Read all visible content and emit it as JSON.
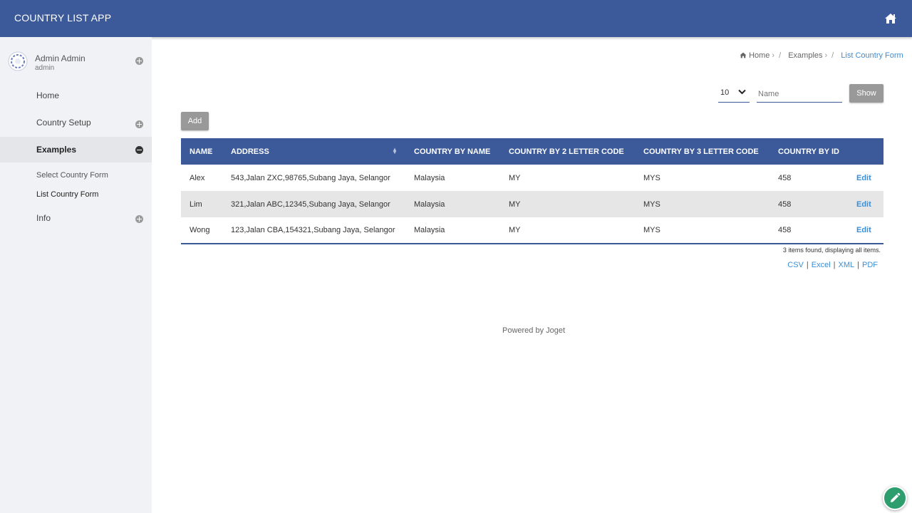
{
  "header": {
    "title": "COUNTRY LIST APP",
    "home_icon": "home-icon"
  },
  "user": {
    "name": "Admin Admin",
    "role": "admin"
  },
  "sidebar": {
    "items": [
      {
        "label": "Home"
      },
      {
        "label": "Country Setup"
      },
      {
        "label": "Examples"
      },
      {
        "label": "Info"
      }
    ],
    "subitems": [
      {
        "label": "Select Country Form"
      },
      {
        "label": "List Country Form"
      }
    ]
  },
  "breadcrumb": {
    "home": "Home",
    "examples": "Examples",
    "current": "List Country Form"
  },
  "filter": {
    "page_size": "10",
    "name_placeholder": "Name",
    "show_label": "Show"
  },
  "toolbar": {
    "add_label": "Add"
  },
  "table": {
    "columns": [
      "NAME",
      "ADDRESS",
      "COUNTRY BY NAME",
      "COUNTRY BY 2 LETTER CODE",
      "COUNTRY BY 3 LETTER CODE",
      "COUNTRY BY ID"
    ],
    "rows": [
      {
        "name": "Alex",
        "address": "543,Jalan ZXC,98765,Subang Jaya, Selangor",
        "country": "Malaysia",
        "code2": "MY",
        "code3": "MYS",
        "id": "458",
        "action": "Edit"
      },
      {
        "name": "Lim",
        "address": "321,Jalan ABC,12345,Subang Jaya, Selangor",
        "country": "Malaysia",
        "code2": "MY",
        "code3": "MYS",
        "id": "458",
        "action": "Edit"
      },
      {
        "name": "Wong",
        "address": "123,Jalan CBA,154321,Subang Jaya, Selangor",
        "country": "Malaysia",
        "code2": "MY",
        "code3": "MYS",
        "id": "458",
        "action": "Edit"
      }
    ],
    "summary": "3 items found, displaying all items."
  },
  "exports": {
    "csv": "CSV",
    "excel": "Excel",
    "xml": "XML",
    "pdf": "PDF",
    "separator": "|"
  },
  "footer": {
    "powered": "Powered by Joget"
  },
  "colors": {
    "primary": "#3c5a99",
    "link": "#3a8ed8",
    "fab": "#2e9e6e",
    "button": "#999999"
  }
}
